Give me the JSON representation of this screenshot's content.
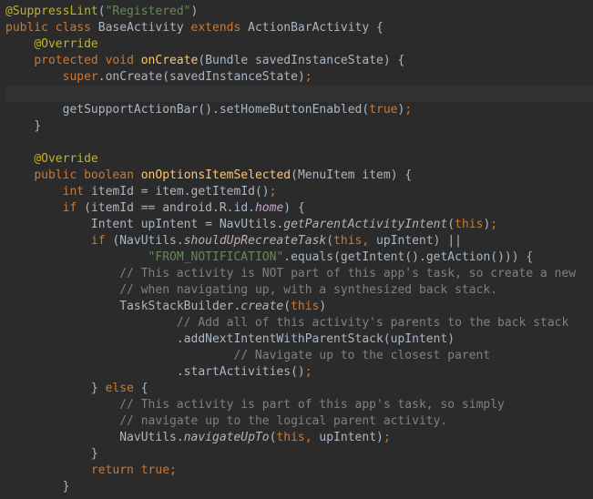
{
  "code": {
    "ann_suppress": "@SuppressLint",
    "ann_suppress_arg": "\"Registered\"",
    "kw_public": "public",
    "kw_class": "class",
    "cls_base": "BaseActivity",
    "kw_extends": "extends",
    "cls_parent": "ActionBarActivity",
    "ann_override": "@Override",
    "kw_protected": "protected",
    "kw_void": "void",
    "fn_onCreate": "onCreate",
    "ty_bundle": "Bundle",
    "p_sis": "savedInstanceState",
    "kw_super": "super",
    "call_onCreate": "onCreate",
    "call_getSupportActionBar": "getSupportActionBar",
    "call_setHomeButtonEnabled": "setHomeButtonEnabled",
    "lit_true": "true",
    "kw_boolean": "boolean",
    "fn_onOptionsItemSelected": "onOptionsItemSelected",
    "ty_menuitem": "MenuItem",
    "p_item": "item",
    "kw_int": "int",
    "v_itemId": "itemId",
    "call_getItemId": "getItemId",
    "kw_if": "if",
    "pkg_android": "android",
    "pkg_R": "R",
    "pkg_id": "id",
    "c_home": "home",
    "ty_intent": "Intent",
    "v_upIntent": "upIntent",
    "cls_navutils": "NavUtils",
    "m_getParentActivityIntent": "getParentActivityIntent",
    "kw_this": "this",
    "m_shouldUpRecreateTask": "shouldUpRecreateTask",
    "str_fromnot": "\"FROM_NOTIFICATION\"",
    "call_equals": "equals",
    "call_getIntent": "getIntent",
    "call_getAction": "getAction",
    "com1": "// This activity is NOT part of this app's task, so create a new",
    "com2": "// when navigating up, with a synthesized back stack.",
    "cls_tsb": "TaskStackBuilder",
    "m_create": "create",
    "com3": "// Add all of this activity's parents to the back stack",
    "call_addNextIntentWithParentStack": "addNextIntentWithParentStack",
    "com4": "// Navigate up to the closest parent",
    "call_startActivities": "startActivities",
    "kw_else": "else",
    "com5": "// This activity is part of this app's task, so simply",
    "com6": "// navigate up to the logical parent activity.",
    "m_navigateUpTo": "navigateUpTo",
    "kw_return": "return"
  }
}
